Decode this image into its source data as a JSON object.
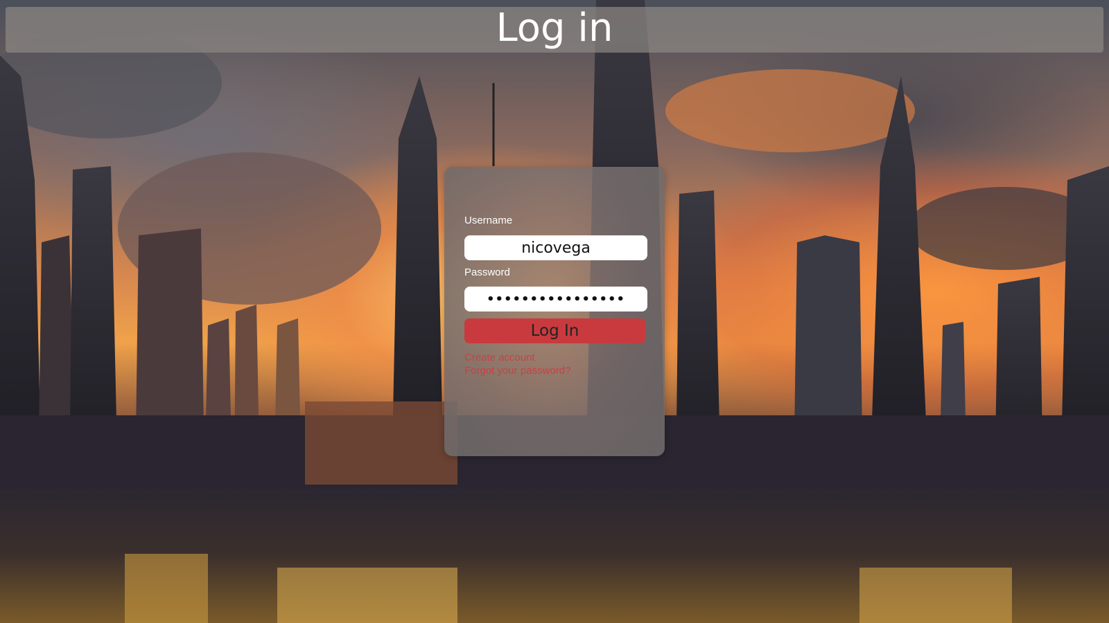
{
  "page": {
    "title": "Log in"
  },
  "login_form": {
    "username_label": "Username",
    "username_value": "nicovega",
    "password_label": "Password",
    "password_value": "••••••••••••••••",
    "submit_label": "Log In",
    "create_account_label": "Create account",
    "forgot_password_label": "Forgot your password?"
  },
  "colors": {
    "button": "#c93a3f",
    "link": "#c94045",
    "header_bar": "rgba(140,135,130,0.72)"
  }
}
